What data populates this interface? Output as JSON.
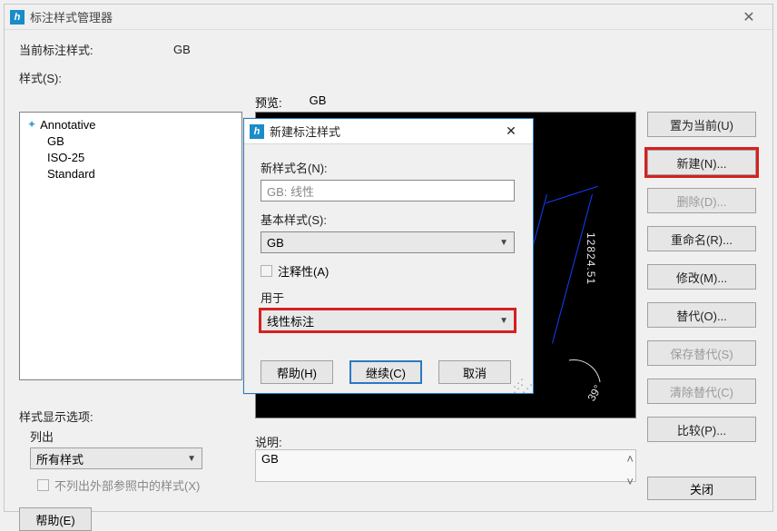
{
  "window": {
    "title": "标注样式管理器"
  },
  "current_style": {
    "label": "当前标注样式:",
    "value": "GB"
  },
  "styles_section": {
    "label": "样式(S):",
    "items": [
      "Annotative",
      "GB",
      "ISO-25",
      "Standard"
    ]
  },
  "preview_section": {
    "label": "预览:",
    "value": "GB",
    "dim_vertical": "12824.51",
    "angle": "39°"
  },
  "description": {
    "label": "说明:",
    "value": "GB"
  },
  "show_options": {
    "label": "样式显示选项:",
    "sub_label": "列出",
    "dropdown_value": "所有样式",
    "ext_ref_checkbox": "不列出外部参照中的样式(X)"
  },
  "buttons": {
    "help": "帮助(E)",
    "close": "关闭",
    "set_current": "置为当前(U)",
    "new": "新建(N)...",
    "delete": "删除(D)...",
    "rename": "重命名(R)...",
    "modify": "修改(M)...",
    "override": "替代(O)...",
    "save_override": "保存替代(S)",
    "clear_override": "清除替代(C)",
    "compare": "比较(P)..."
  },
  "new_dialog": {
    "title": "新建标注样式",
    "new_name_label": "新样式名(N):",
    "new_name_value": "GB: 线性",
    "base_style_label": "基本样式(S):",
    "base_style_value": "GB",
    "annotative_label": "注释性(A)",
    "use_for_label": "用于",
    "use_for_value": "线性标注",
    "help": "帮助(H)",
    "continue": "继续(C)",
    "cancel": "取消"
  }
}
